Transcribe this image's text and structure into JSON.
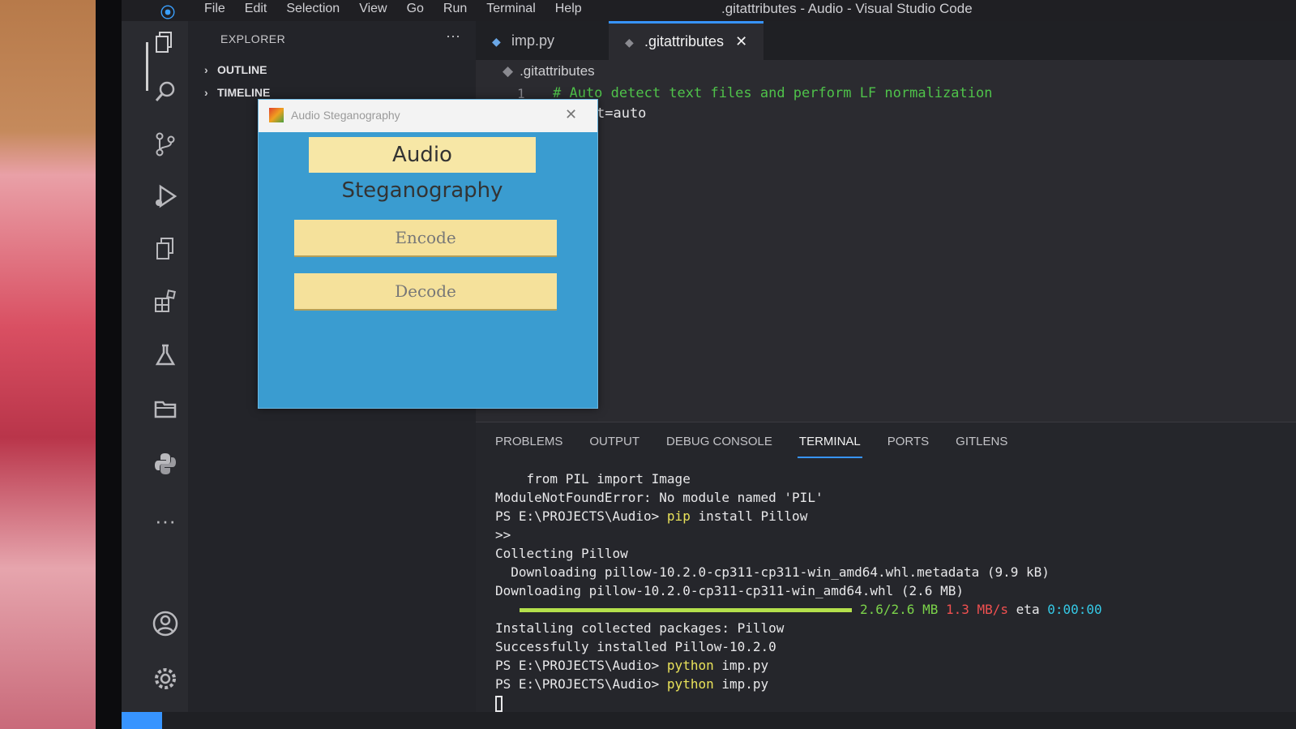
{
  "window": {
    "title": ".gitattributes - Audio - Visual Studio Code"
  },
  "menu": [
    "File",
    "Edit",
    "Selection",
    "View",
    "Go",
    "Run",
    "Terminal",
    "Help"
  ],
  "activity_bar": [
    "explorer-icon",
    "search-icon",
    "source-control-icon",
    "run-debug-icon",
    "copy-icon",
    "extensions-icon",
    "testing-icon",
    "folder-icon",
    "python-icon",
    "more-icon",
    "account-icon",
    "settings-gear-icon"
  ],
  "sidebar": {
    "title": "EXPLORER",
    "more": "···",
    "sections": [
      "OUTLINE",
      "TIMELINE"
    ]
  },
  "tabs": [
    {
      "label": "imp.py",
      "active": false
    },
    {
      "label": ".gitattributes",
      "active": true
    }
  ],
  "editor": {
    "breadcrumb": ".gitattributes",
    "lines": [
      {
        "number": "1",
        "text": "# Auto detect text files and perform LF normalization"
      },
      {
        "number": "",
        "text": "t=auto"
      }
    ]
  },
  "panel": {
    "tabs": [
      "PROBLEMS",
      "OUTPUT",
      "DEBUG CONSOLE",
      "TERMINAL",
      "PORTS",
      "GITLENS"
    ],
    "active_tab": "TERMINAL",
    "terminal": {
      "l1": "    from PIL import Image",
      "l2": "ModuleNotFoundError: No module named 'PIL'",
      "prompt": "PS E:\\PROJECTS\\Audio> ",
      "l3_cmd": "pip",
      "l3_args": " install Pillow",
      "l4": ">>",
      "l5": "Collecting Pillow",
      "l6": "  Downloading pillow-10.2.0-cp311-cp311-win_amd64.whl.metadata (9.9 kB)",
      "l7": "Downloading pillow-10.2.0-cp311-cp311-win_amd64.whl (2.6 MB)",
      "progress": 1.0,
      "progress_size": "2.6/2.6 MB",
      "progress_speed": "1.3 MB/s",
      "progress_eta_label": "eta",
      "progress_eta": "0:00:00",
      "l9": "Installing collected packages: Pillow",
      "l10": "Successfully installed Pillow-10.2.0",
      "l11_cmd": "python",
      "l11_args": " imp.py",
      "l12_cmd": "python",
      "l12_args": " imp.py"
    }
  },
  "app_window": {
    "title": "Audio Steganography",
    "close": "✕",
    "heading": "Audio Steganography",
    "encode_label": "Encode",
    "decode_label": "Decode"
  }
}
